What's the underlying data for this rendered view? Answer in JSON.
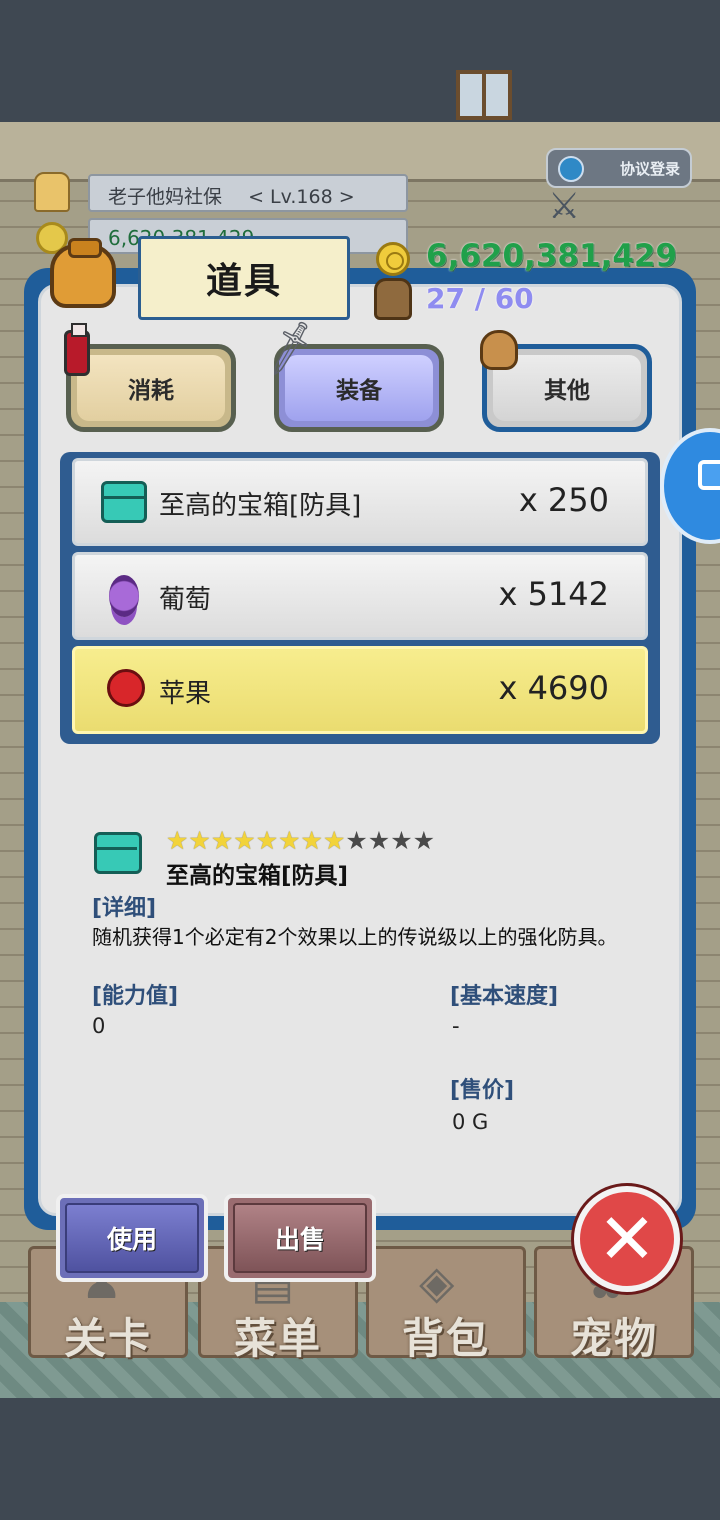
{
  "player": {
    "name": "老子他妈社保",
    "level": "< Lv.168 >",
    "gold_short": "6,620,381,429"
  },
  "header": {
    "title": "道具",
    "gold": "6,620,381,429",
    "capacity": "27 / 60",
    "coop_label": "协议登录"
  },
  "tabs": [
    {
      "label": "消耗",
      "icon": "potion-icon",
      "selected": false
    },
    {
      "label": "装备",
      "icon": "sword-icon",
      "selected": true
    },
    {
      "label": "其他",
      "icon": "sack-icon",
      "selected": false
    }
  ],
  "items": [
    {
      "name": "至高的宝箱[防具]",
      "qty": "x 250",
      "icon": "chest-icon",
      "selected": false
    },
    {
      "name": "葡萄",
      "qty": "x 5142",
      "icon": "grape-icon",
      "selected": false
    },
    {
      "name": "苹果",
      "qty": "x 4690",
      "icon": "apple-icon",
      "selected": true
    }
  ],
  "detail": {
    "stars_filled": 8,
    "stars_total": 12,
    "name": "至高的宝箱[防具]",
    "detail_label": "[详细]",
    "description": "随机获得1个必定有2个效果以上的传说级以上的强化防具。",
    "ability_label": "[能力值]",
    "ability_value": "0",
    "speed_label": "[基本速度]",
    "speed_value": "-",
    "price_label": "[售价]",
    "price_value": "0 G"
  },
  "actions": {
    "use": "使用",
    "sell": "出售"
  },
  "nav": [
    {
      "label": "关卡",
      "icon": "stage-icon"
    },
    {
      "label": "菜单",
      "icon": "menu-icon"
    },
    {
      "label": "背包",
      "icon": "backpack-icon"
    },
    {
      "label": "宠物",
      "icon": "pet-icon"
    }
  ],
  "colors": {
    "panel_border": "#1f5d9a",
    "selected_row": "#f0e47e",
    "gold_text": "#20a04a",
    "capacity_text": "#8f8cf0",
    "close": "#e04848"
  }
}
